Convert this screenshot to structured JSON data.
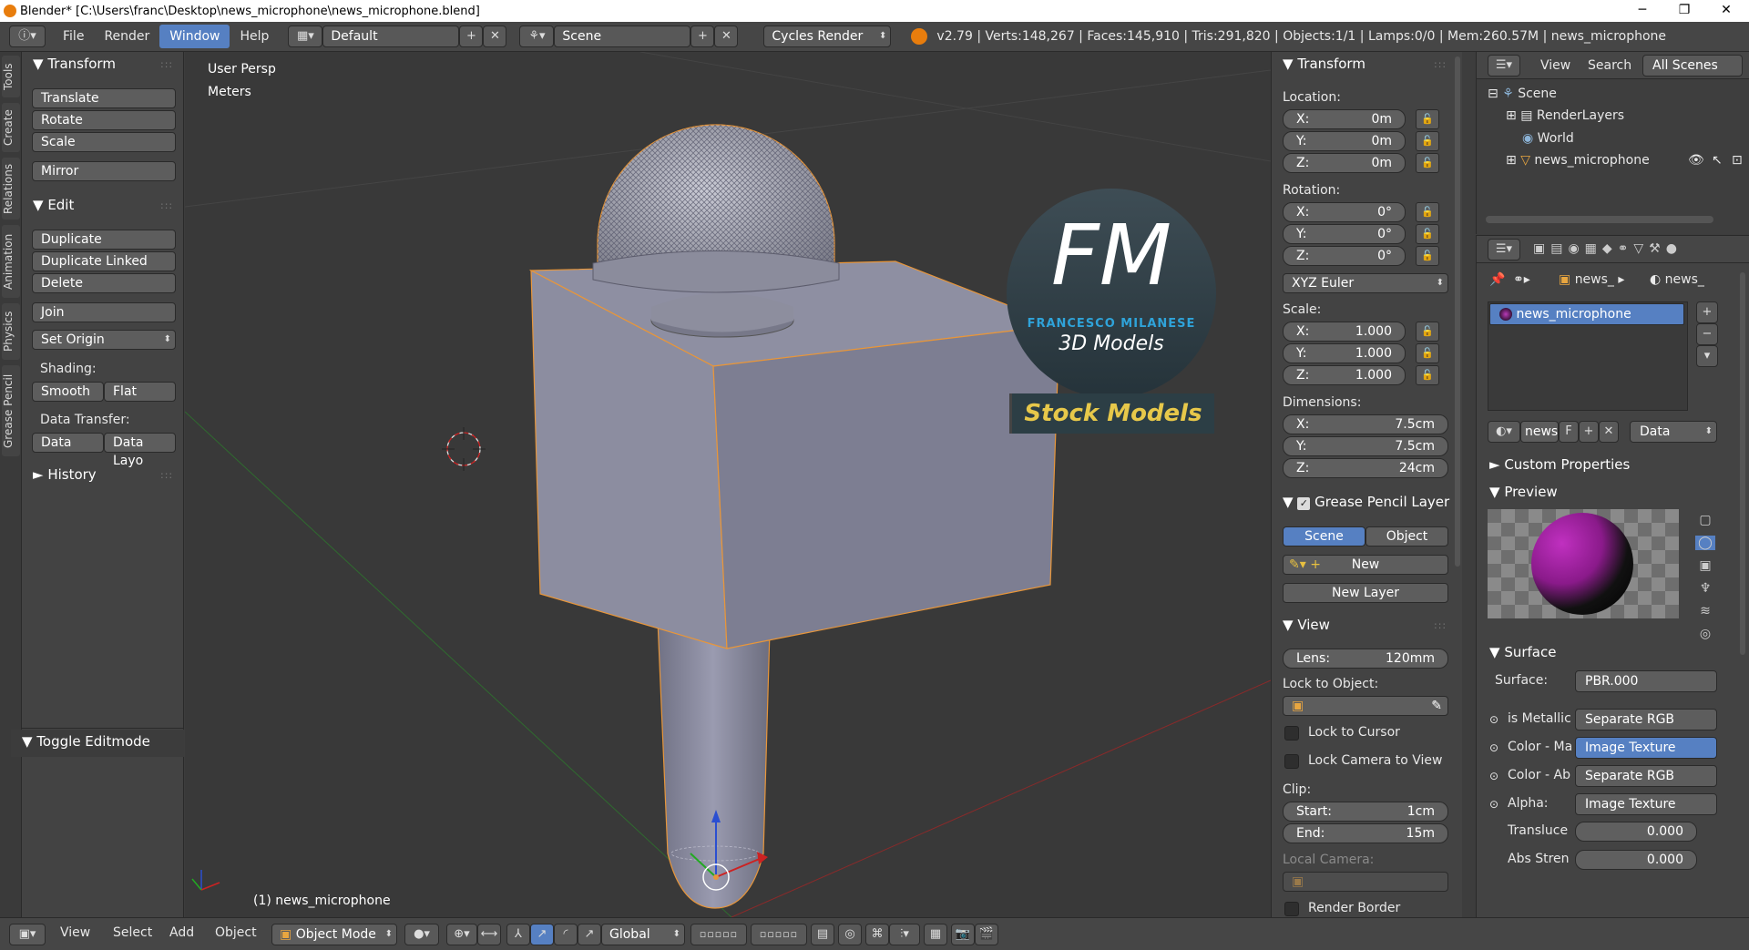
{
  "window": {
    "title": "Blender* [C:\\Users\\franc\\Desktop\\news_microphone\\news_microphone.blend]",
    "minimize": "─",
    "maximize": "❐",
    "close": "✕"
  },
  "infobar": {
    "menus": [
      "File",
      "Render",
      "Window",
      "Help"
    ],
    "layout": "Default",
    "scene": "Scene",
    "engine": "Cycles Render",
    "stats": "v2.79 | Verts:148,267 | Faces:145,910 | Tris:291,820 | Objects:1/1 | Lamps:0/0 | Mem:260.57M | news_microphone"
  },
  "left_tabs": [
    "Tools",
    "Create",
    "Relations",
    "Animation",
    "Physics",
    "Grease Pencil"
  ],
  "toolshelf": {
    "transform": {
      "title": "Transform",
      "buttons": [
        "Translate",
        "Rotate",
        "Scale",
        "Mirror"
      ]
    },
    "edit": {
      "title": "Edit",
      "buttons": [
        "Duplicate",
        "Duplicate Linked",
        "Delete",
        "Join"
      ],
      "set_origin": "Set Origin",
      "shading_label": "Shading:",
      "smooth": "Smooth",
      "flat": "Flat",
      "data_transfer_label": "Data Transfer:",
      "data": "Data",
      "data_layout": "Data Layo"
    },
    "history": "History",
    "toggle_editmode": "Toggle Editmode"
  },
  "viewport": {
    "view_name": "User Persp",
    "units": "Meters",
    "object_label": "(1) news_microphone",
    "logo_letters": "FM",
    "logo_name": "FRANCESCO MILANESE",
    "logo_sub": "3D Models",
    "stock": "Stock Models"
  },
  "npanel": {
    "transform_title": "Transform",
    "location_label": "Location:",
    "loc": [
      {
        "k": "X:",
        "v": "0m"
      },
      {
        "k": "Y:",
        "v": "0m"
      },
      {
        "k": "Z:",
        "v": "0m"
      }
    ],
    "rotation_label": "Rotation:",
    "rot": [
      {
        "k": "X:",
        "v": "0°"
      },
      {
        "k": "Y:",
        "v": "0°"
      },
      {
        "k": "Z:",
        "v": "0°"
      }
    ],
    "rot_mode": "XYZ Euler",
    "scale_label": "Scale:",
    "scale": [
      {
        "k": "X:",
        "v": "1.000"
      },
      {
        "k": "Y:",
        "v": "1.000"
      },
      {
        "k": "Z:",
        "v": "1.000"
      }
    ],
    "dim_label": "Dimensions:",
    "dim": [
      {
        "k": "X:",
        "v": "7.5cm"
      },
      {
        "k": "Y:",
        "v": "7.5cm"
      },
      {
        "k": "Z:",
        "v": "24cm"
      }
    ],
    "gp_title": "Grease Pencil Layer",
    "gp_scene": "Scene",
    "gp_object": "Object",
    "gp_new": "New",
    "gp_new_layer": "New Layer",
    "view_title": "View",
    "lens_k": "Lens:",
    "lens_v": "120mm",
    "lock_obj": "Lock to Object:",
    "lock_cursor": "Lock to Cursor",
    "lock_camera": "Lock Camera to View",
    "clip_label": "Clip:",
    "start_k": "Start:",
    "start_v": "1cm",
    "end_k": "End:",
    "end_v": "15m",
    "local_camera": "Local Camera:",
    "render_border": "Render Border"
  },
  "outliner": {
    "view": "View",
    "search": "Search",
    "all_scenes": "All Scenes",
    "items": [
      "Scene",
      "RenderLayers",
      "World",
      "news_microphone"
    ]
  },
  "props": {
    "crumb1": "news_",
    "crumb2": "news_",
    "material": "news_microphone",
    "mat_short": "news",
    "f": "F",
    "data": "Data",
    "custom": "Custom Properties",
    "preview": "Preview",
    "surface_title": "Surface",
    "surface_k": "Surface:",
    "surface_v": "PBR.000",
    "rows": [
      {
        "k": "is Metallic",
        "v": "Separate RGB"
      },
      {
        "k": "Color - Ma",
        "v": "Image Texture"
      },
      {
        "k": "Color - Ab",
        "v": "Separate RGB"
      },
      {
        "k": "Alpha:",
        "v": "Image Texture"
      }
    ],
    "transluce_k": "Transluce",
    "transluce_v": "0.000",
    "abs_k": "Abs Stren",
    "abs_v": "0.000"
  },
  "bottombar": {
    "menus": [
      "View",
      "Select",
      "Add",
      "Object"
    ],
    "mode": "Object Mode",
    "orientation": "Global"
  }
}
